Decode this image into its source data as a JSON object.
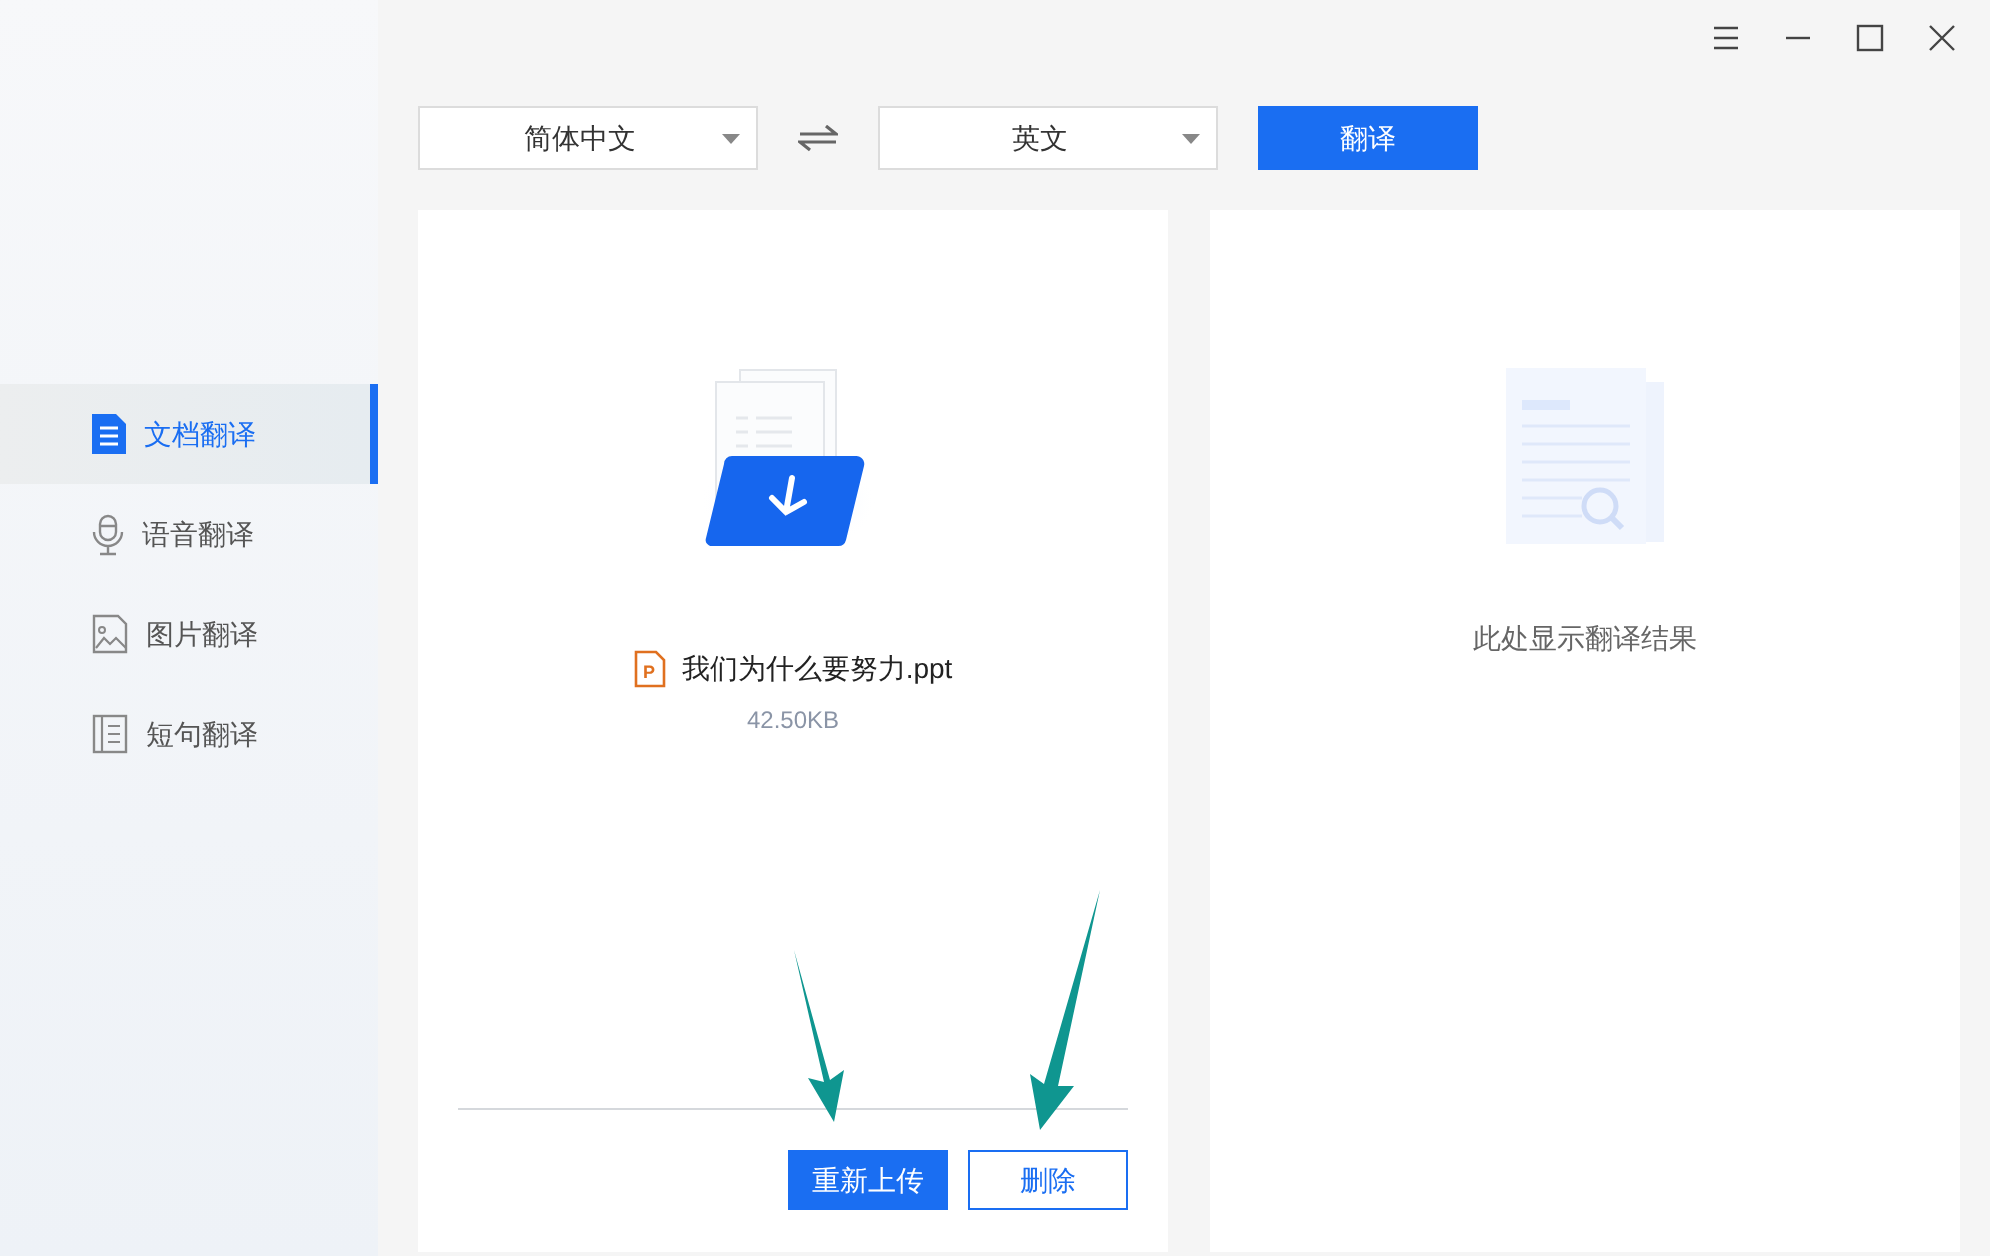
{
  "sidebar": {
    "items": [
      {
        "label": "文档翻译",
        "kind": "document",
        "selected": true
      },
      {
        "label": "语音翻译",
        "kind": "voice",
        "selected": false
      },
      {
        "label": "图片翻译",
        "kind": "image",
        "selected": false
      },
      {
        "label": "短句翻译",
        "kind": "sentence",
        "selected": false
      }
    ]
  },
  "toolbar": {
    "source_language": "简体中文",
    "target_language": "英文",
    "translate_button": "翻译"
  },
  "upload_panel": {
    "file_icon_letter": "P",
    "file_name": "我们为什么要努力.ppt",
    "file_size": "42.50KB",
    "buttons": [
      {
        "label": "重新上传",
        "kind": "primary"
      },
      {
        "label": "删除",
        "kind": "outline"
      }
    ]
  },
  "result_panel": {
    "empty_message": "此处显示翻译结果"
  }
}
